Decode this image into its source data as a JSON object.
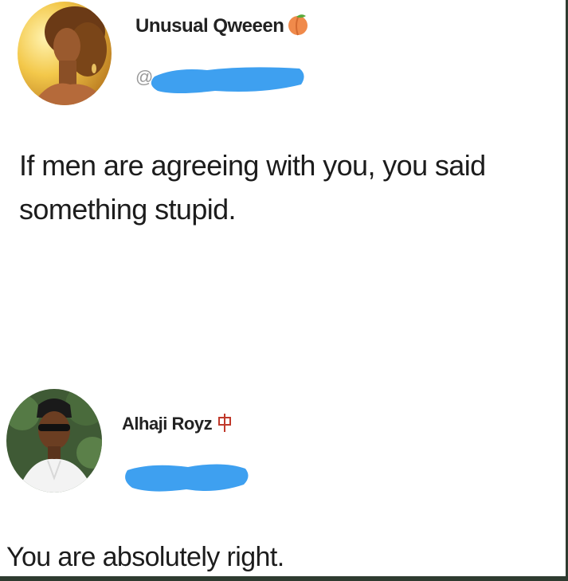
{
  "posts": [
    {
      "author": "Unusual Qweeen",
      "badge_icon": "peach-emoji-icon",
      "handle_prefix": "@",
      "text": "If men are agreeing with you, you said\nsomething stupid."
    },
    {
      "author": "Alhaji Royz",
      "badge_icon": "cjk-glyph-icon",
      "handle_prefix": "",
      "text": "You are absolutely right."
    }
  ],
  "colors": {
    "redaction": "#3ea0f0",
    "frame": "#2e3b30"
  }
}
